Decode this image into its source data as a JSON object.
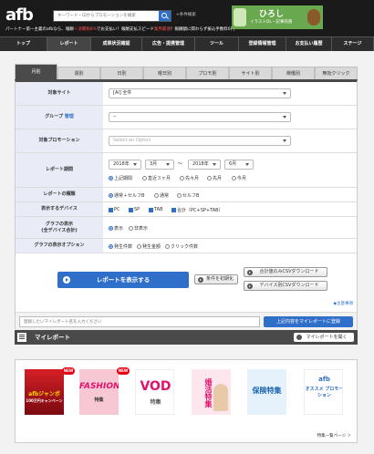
{
  "header": {
    "logo_text": "afb",
    "search_placeholder": "キーワード・IDからプロモーションを検索",
    "cond_search": "+条件検索",
    "tagline_part1": "パートナー第一主義のafbなら、報酬",
    "tagline_red1": "＋消費税8%",
    "tagline_part2": "でお支払い！報酬支払スピード",
    "tagline_red2": "業界最速",
    "tagline_part3": "！報酬額に関わらず振込手数料0円",
    "banner_title": "ひろし",
    "banner_sub": "イラストDL・記事売買"
  },
  "nav": {
    "items": [
      "トップ",
      "レポート",
      "成果状況確認",
      "広告・提携管理",
      "ツール",
      "登録情報管理",
      "お支払い履歴",
      "ステージ"
    ],
    "active_index": 1
  },
  "tabs": {
    "items": [
      "月別",
      "週別",
      "日別",
      "曜日別",
      "プロモ別",
      "サイト別",
      "稼働別",
      "無効クリック"
    ],
    "active_index": 0
  },
  "form": {
    "site_label": "対象サイト",
    "site_value": "[AI] 全件",
    "group_label": "グループ",
    "group_link": "管理",
    "group_value": "--",
    "promo_label": "対象プロモーション",
    "promo_placeholder": "Select an Option",
    "period_label": "レポート期間",
    "period_from_year": "2018年",
    "period_from_month": "3月",
    "period_to_year": "2018年",
    "period_to_month": "6月",
    "period_sep": "〜",
    "period_options": [
      "上記期間",
      "直近３ヶ月",
      "先々月",
      "先月",
      "今月"
    ],
    "period_selected": 0,
    "type_label": "レポートの種類",
    "type_options": [
      "通常＋セルフB",
      "通常",
      "セルフB"
    ],
    "type_selected": 0,
    "device_label": "表示するデバイス",
    "device_options": [
      "PC",
      "SP",
      "TAB",
      "合計（PC+SP+TAB）"
    ],
    "graph_label1": "グラフの表示",
    "graph_label2": "(全デバイス合計)",
    "graph_options": [
      "表示",
      "非表示"
    ],
    "graph_selected": 0,
    "graphopt_label": "グラフの表示オプション",
    "graphopt_options": [
      "発生件数",
      "発生金額",
      "クリック件数"
    ],
    "graphopt_selected": 0
  },
  "buttons": {
    "show_report": "レポートを表示する",
    "reset": "条件を初期化",
    "csv_total": "合計値のみCSVダウンロード",
    "csv_device": "デバイス別CSVダウンロード",
    "notes": "◆注意事項",
    "my_placeholder": "登録したいマイレポート名を入力ください",
    "my_save": "上記内容をマイレポートに登録"
  },
  "myreport": {
    "title": "マイレポート",
    "open": "マイレポートを開く"
  },
  "features": {
    "items": [
      {
        "badge": "NEW",
        "title": "afbジャンボ",
        "sub": "100万円キャンペーン"
      },
      {
        "badge": "NEW",
        "title": "FASHION",
        "sub": "特集"
      },
      {
        "badge": "",
        "title": "VOD",
        "sub": "特集"
      },
      {
        "badge": "",
        "title": "婚活特集",
        "sub": ""
      },
      {
        "badge": "",
        "title": "保険特集",
        "sub": ""
      },
      {
        "badge": "",
        "title": "afb",
        "sub": "オススメ プロモーション"
      }
    ],
    "link": "特集一覧ページ ＞"
  },
  "colors": {
    "accent": "#2f6fc9",
    "header_bg": "#1a1a1a",
    "nav_bg": "#2d2d2d",
    "label_bg": "#e9ecf6"
  }
}
